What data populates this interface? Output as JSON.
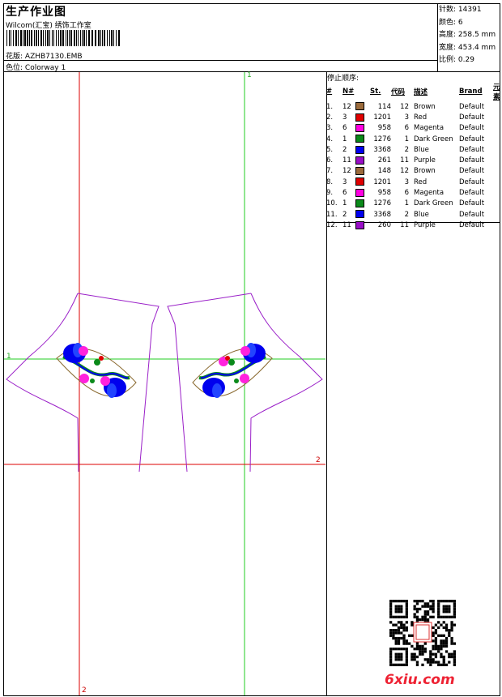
{
  "header": {
    "title": "生产作业图",
    "subtitle": "Wilcom(汇宝) 绣饰工作室",
    "design_label": "花版:",
    "design_file": "AZHB7130.EMB",
    "colorway_label": "色位:",
    "colorway": "Colorway 1"
  },
  "stats": {
    "stitches_label": "针数:",
    "stitches": "14391",
    "colors_label": "颜色:",
    "colors": "6",
    "height_label": "高度:",
    "height": "258.5 mm",
    "width_label": "宽度:",
    "width": "453.4 mm",
    "scale_label": "比例:",
    "scale": "0.29"
  },
  "stop_sequence": {
    "title": "停止顺序:",
    "headers": {
      "idx": "#",
      "n": "N#",
      "st": "St.",
      "code": "代码",
      "desc": "描述",
      "brand": "Brand",
      "elem": "元素"
    },
    "rows": [
      {
        "idx": "1.",
        "n": "12",
        "color": "#9b6b3c",
        "st": "114",
        "code": "12",
        "desc": "Brown",
        "brand": "Default"
      },
      {
        "idx": "2.",
        "n": "3",
        "color": "#e00000",
        "st": "1201",
        "code": "3",
        "desc": "Red",
        "brand": "Default"
      },
      {
        "idx": "3.",
        "n": "6",
        "color": "#ff00e0",
        "st": "958",
        "code": "6",
        "desc": "Magenta",
        "brand": "Default"
      },
      {
        "idx": "4.",
        "n": "1",
        "color": "#0a8a1a",
        "st": "1276",
        "code": "1",
        "desc": "Dark Green",
        "brand": "Default"
      },
      {
        "idx": "5.",
        "n": "2",
        "color": "#0000ee",
        "st": "3368",
        "code": "2",
        "desc": "Blue",
        "brand": "Default"
      },
      {
        "idx": "6.",
        "n": "11",
        "color": "#9a0fc8",
        "st": "261",
        "code": "11",
        "desc": "Purple",
        "brand": "Default"
      },
      {
        "idx": "7.",
        "n": "12",
        "color": "#9b6b3c",
        "st": "148",
        "code": "12",
        "desc": "Brown",
        "brand": "Default"
      },
      {
        "idx": "8.",
        "n": "3",
        "color": "#e00000",
        "st": "1201",
        "code": "3",
        "desc": "Red",
        "brand": "Default"
      },
      {
        "idx": "9.",
        "n": "6",
        "color": "#ff00e0",
        "st": "958",
        "code": "6",
        "desc": "Magenta",
        "brand": "Default"
      },
      {
        "idx": "10.",
        "n": "1",
        "color": "#0a8a1a",
        "st": "1276",
        "code": "1",
        "desc": "Dark Green",
        "brand": "Default"
      },
      {
        "idx": "11.",
        "n": "2",
        "color": "#0000ee",
        "st": "3368",
        "code": "2",
        "desc": "Blue",
        "brand": "Default"
      },
      {
        "idx": "12.",
        "n": "11",
        "color": "#9a0fc8",
        "st": "260",
        "code": "11",
        "desc": "Purple",
        "brand": "Default"
      }
    ]
  },
  "guides": {
    "green_top": "1",
    "green_left": "1",
    "red_right": "2",
    "red_bottom": "2"
  },
  "watermark": "6xiu.com",
  "colors": {
    "guide_green": "#22cc22",
    "guide_red": "#dd0000",
    "outline": "#9a1fc8"
  }
}
